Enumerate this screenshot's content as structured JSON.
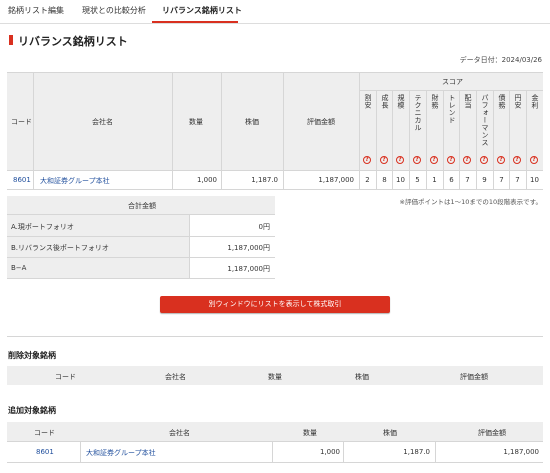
{
  "tabs": [
    {
      "label": "銘柄リスト編集"
    },
    {
      "label": "現状との比較分析"
    },
    {
      "label": "リバランス銘柄リスト"
    }
  ],
  "page_title": "リバランス銘柄リスト",
  "date_label": "データ日付：2024/03/26",
  "main_table": {
    "headers": {
      "code": "コード",
      "company": "会社名",
      "quantity": "数量",
      "price": "株価",
      "valuation": "評価金額",
      "score": "スコア"
    },
    "score_headers": [
      "割安",
      "成長",
      "規模",
      "テクニカル",
      "財務",
      "トレンド",
      "配当",
      "パフォーマンス",
      "債務",
      "円安",
      "金利"
    ],
    "help_icon": "?",
    "row": {
      "code": "8601",
      "company": "大和証券グループ本社",
      "quantity": "1,000",
      "price": "1,187.0",
      "valuation": "1,187,000",
      "scores": [
        "2",
        "8",
        "10",
        "5",
        "1",
        "6",
        "7",
        "9",
        "7",
        "7",
        "10"
      ]
    }
  },
  "score_note": "※評価ポイントは1〜10までの10段階表示です。",
  "summary": {
    "header": "合計金額",
    "rows": [
      {
        "label": "A.現ポートフォリオ",
        "value": "0円"
      },
      {
        "label": "B.リバランス後ポートフォリオ",
        "value": "1,187,000円"
      },
      {
        "label": "B−A",
        "value": "1,187,000円"
      }
    ]
  },
  "trade_button": "別ウィンドウにリストを表示して株式取引",
  "removed_section": {
    "title": "削除対象銘柄",
    "headers": [
      "コード",
      "会社名",
      "数量",
      "株価",
      "評価金額"
    ]
  },
  "added_section": {
    "title": "追加対象銘柄",
    "headers": [
      "コード",
      "会社名",
      "数量",
      "株価",
      "評価金額"
    ],
    "row": {
      "code": "8601",
      "company": "大和証券グループ本社",
      "quantity": "1,000",
      "price": "1,187.0",
      "valuation": "1,187,000"
    }
  },
  "colors": {
    "accent": "#d9301f",
    "link": "#1f4e9c",
    "header_bg": "#eeeeee"
  }
}
